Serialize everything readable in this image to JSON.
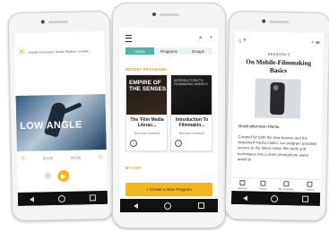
{
  "left_phone": {
    "header_title": "Karate Kurosawa: Studio Studies / Lambe...",
    "video_title": "LOW ANGLE",
    "time_elapsed": "00:00",
    "time_total": "00:06",
    "close_icon": "close-icon",
    "play_icon": "play-icon",
    "info_icon": "info-icon"
  },
  "center_phone": {
    "tabs": [
      {
        "label": "Home"
      },
      {
        "label": "Programs"
      },
      {
        "label": "Groups"
      }
    ],
    "section_recent": "RECENT PROGRAMS",
    "section_mylist": "MY LIST",
    "cards": [
      {
        "art_title": "EMPIRE OF THE SENSES",
        "title": "The 'Film Media Literac...",
        "author": "Brendan Bradford"
      },
      {
        "art_title": "INTRODUCTION TO FILMMAKING MODELS",
        "title": "Introduction To Filmmakin...",
        "author": "Brendan Bradford"
      }
    ],
    "cta_label": "+ Create a New Program"
  },
  "right_phone": {
    "kicker": "SESSION 5",
    "title": "On Mobile-Filmmaking Basics",
    "greeting": "Good afternoon Merlin,",
    "body": "Curated for both the new learner and the seasoned media maker, our program provides access to the latest online film tools and techniques into current smartphone users stand to",
    "tabbar": [
      {
        "label": "Session"
      },
      {
        "label": "Group"
      },
      {
        "label": "My Progress"
      },
      {
        "label": "Activity"
      }
    ]
  },
  "colors": {
    "accent_yellow": "#f2b71f",
    "accent_teal": "#4ab7ad",
    "section_orange": "#e2a21b"
  }
}
